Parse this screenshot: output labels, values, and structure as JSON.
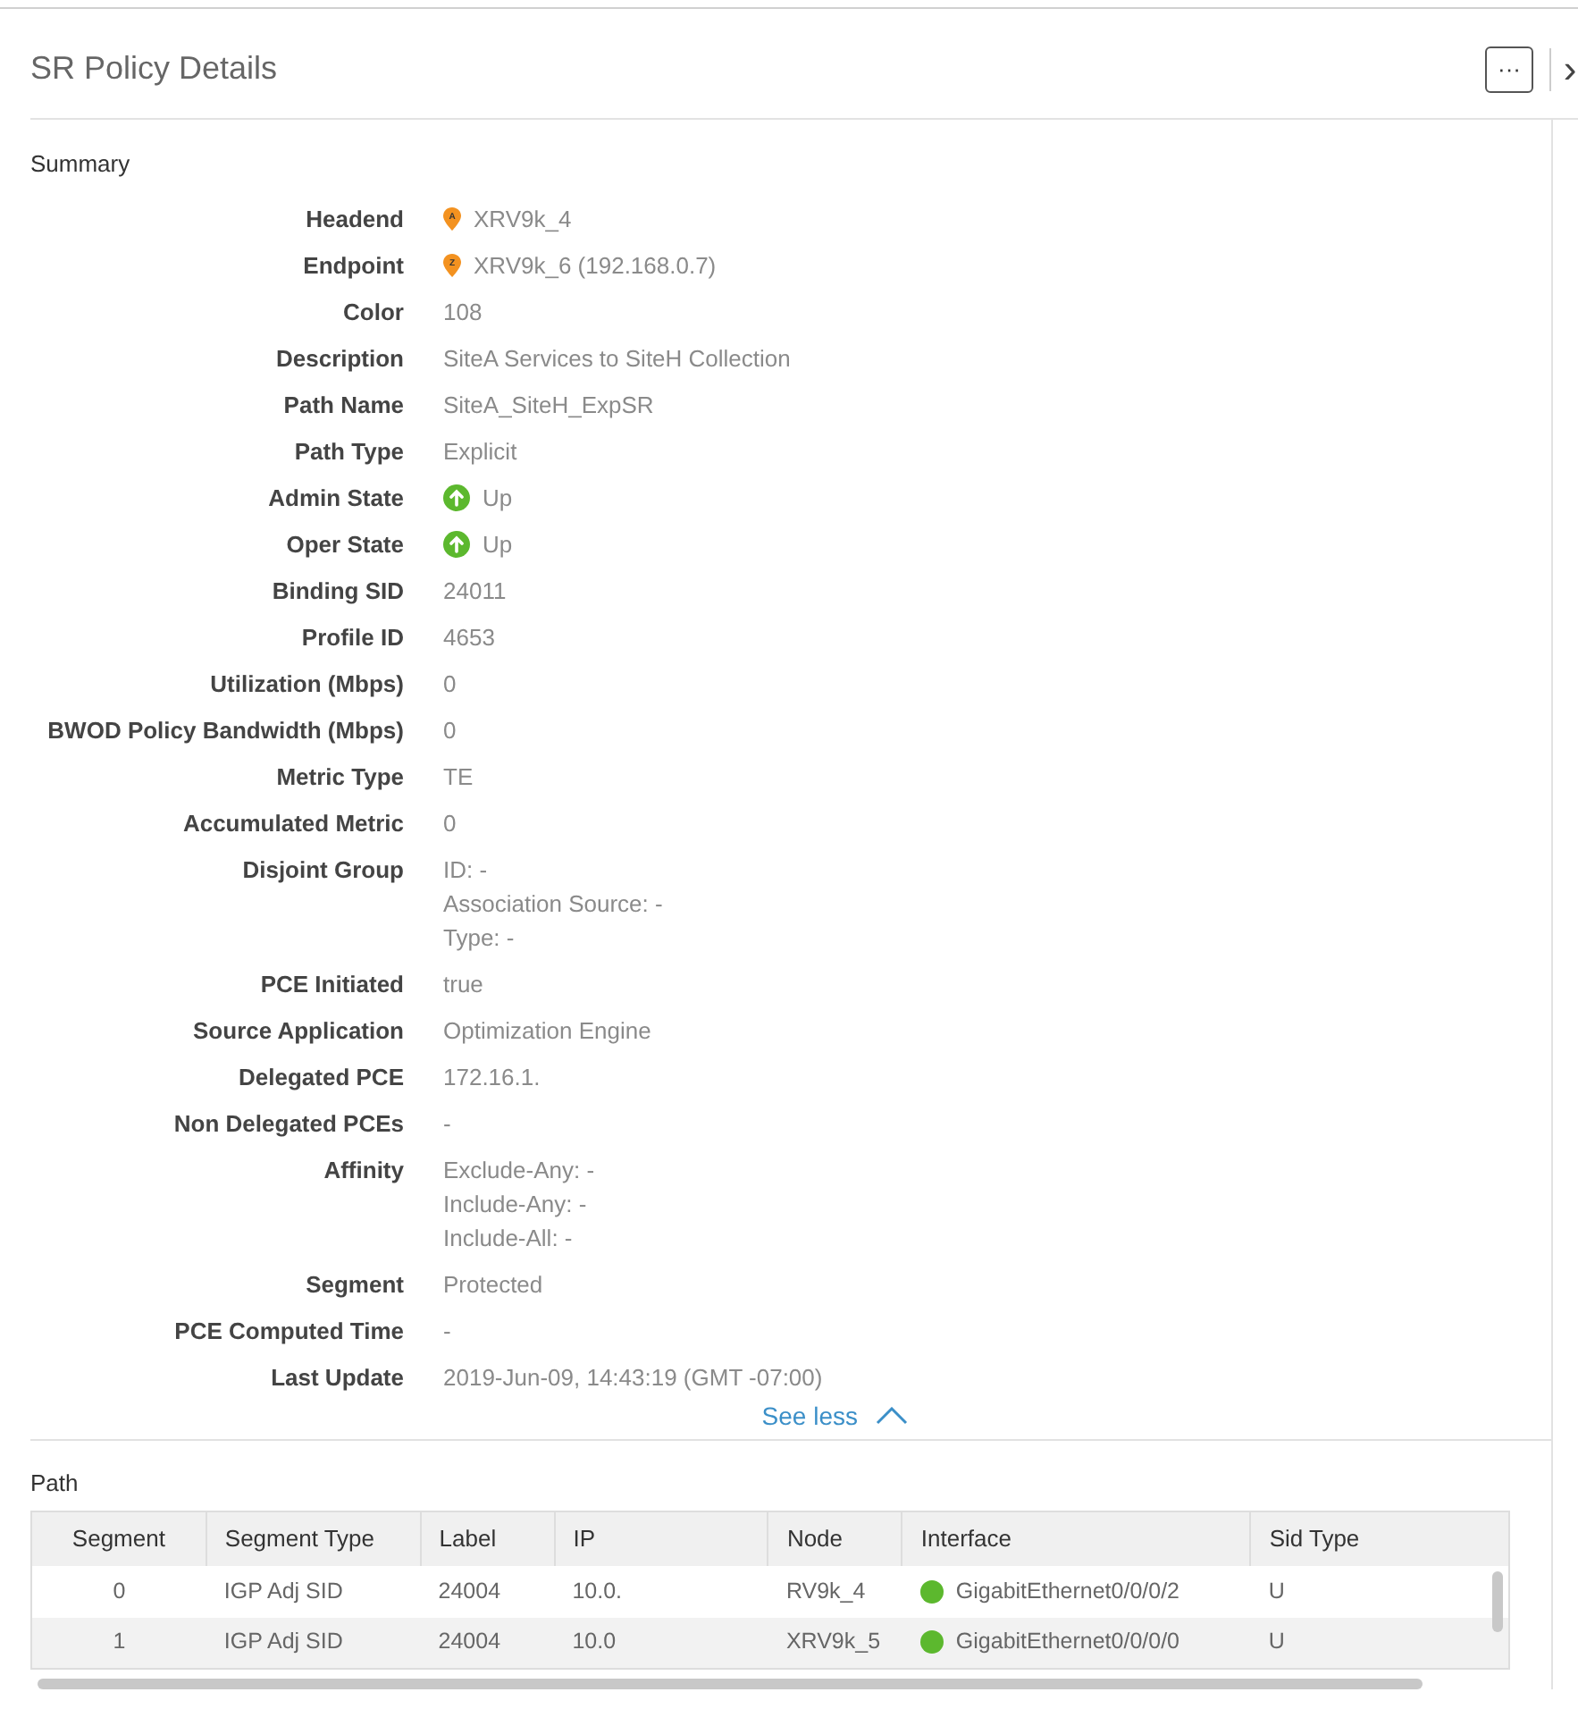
{
  "panel": {
    "title": "SR Policy Details",
    "more_button": "···",
    "close_button": "›"
  },
  "summary": {
    "heading": "Summary",
    "fields": [
      {
        "label": "Headend",
        "kind": "pin",
        "marker": "A",
        "lines": [
          "XRV9k_4"
        ]
      },
      {
        "label": "Endpoint",
        "kind": "pin",
        "marker": "Z",
        "lines": [
          "XRV9k_6 (192.168.0.7)"
        ]
      },
      {
        "label": "Color",
        "kind": "text",
        "lines": [
          "108"
        ]
      },
      {
        "label": "Description",
        "kind": "text",
        "lines": [
          "SiteA Services to SiteH Collection"
        ]
      },
      {
        "label": "Path Name",
        "kind": "text",
        "lines": [
          "SiteA_SiteH_ExpSR"
        ]
      },
      {
        "label": "Path Type",
        "kind": "text",
        "lines": [
          "Explicit"
        ]
      },
      {
        "label": "Admin State",
        "kind": "up",
        "lines": [
          "Up"
        ]
      },
      {
        "label": "Oper State",
        "kind": "up",
        "lines": [
          "Up"
        ]
      },
      {
        "label": "Binding SID",
        "kind": "text",
        "lines": [
          "24011"
        ]
      },
      {
        "label": "Profile ID",
        "kind": "text",
        "lines": [
          "4653"
        ]
      },
      {
        "label": "Utilization (Mbps)",
        "kind": "text",
        "lines": [
          "0"
        ]
      },
      {
        "label": "BWOD Policy Bandwidth (Mbps)",
        "kind": "text",
        "lines": [
          "0"
        ]
      },
      {
        "label": "Metric Type",
        "kind": "text",
        "lines": [
          "TE"
        ]
      },
      {
        "label": "Accumulated Metric",
        "kind": "text",
        "lines": [
          "0"
        ]
      },
      {
        "label": "Disjoint Group",
        "kind": "text",
        "lines": [
          "ID: -",
          "Association Source: -",
          "Type: -"
        ]
      },
      {
        "label": "PCE Initiated",
        "kind": "text",
        "lines": [
          "true"
        ]
      },
      {
        "label": "Source Application",
        "kind": "text",
        "lines": [
          "Optimization Engine"
        ]
      },
      {
        "label": "Delegated PCE",
        "kind": "text",
        "lines": [
          "172.16.1."
        ]
      },
      {
        "label": "Non Delegated PCEs",
        "kind": "text",
        "lines": [
          "-"
        ]
      },
      {
        "label": "Affinity",
        "kind": "text",
        "lines": [
          "Exclude-Any: -",
          "Include-Any: -",
          "Include-All: -"
        ]
      },
      {
        "label": "Segment",
        "kind": "text",
        "lines": [
          "Protected"
        ]
      },
      {
        "label": "PCE Computed Time",
        "kind": "text",
        "lines": [
          "-"
        ]
      },
      {
        "label": "Last Update",
        "kind": "text",
        "lines": [
          "2019-Jun-09, 14:43:19 (GMT -07:00)"
        ]
      }
    ],
    "toggle": {
      "label": "See less",
      "expanded": true
    }
  },
  "path": {
    "heading": "Path",
    "table": {
      "columns": [
        "Segment",
        "Segment Type",
        "Label",
        "IP",
        "Node",
        "Interface",
        "Sid Type"
      ],
      "rows": [
        {
          "cells": [
            "0",
            "IGP Adj SID",
            "24004",
            "10.0.",
            "RV9k_4",
            "GigabitEthernet0/0/0/2",
            "U"
          ],
          "color": "#5cb82e"
        },
        {
          "cells": [
            "1",
            "IGP Adj SID",
            "24004",
            "10.0",
            "XRV9k_5",
            "GigabitEthernet0/0/0/0",
            "U"
          ],
          "color": "#5cb82e"
        }
      ]
    }
  }
}
